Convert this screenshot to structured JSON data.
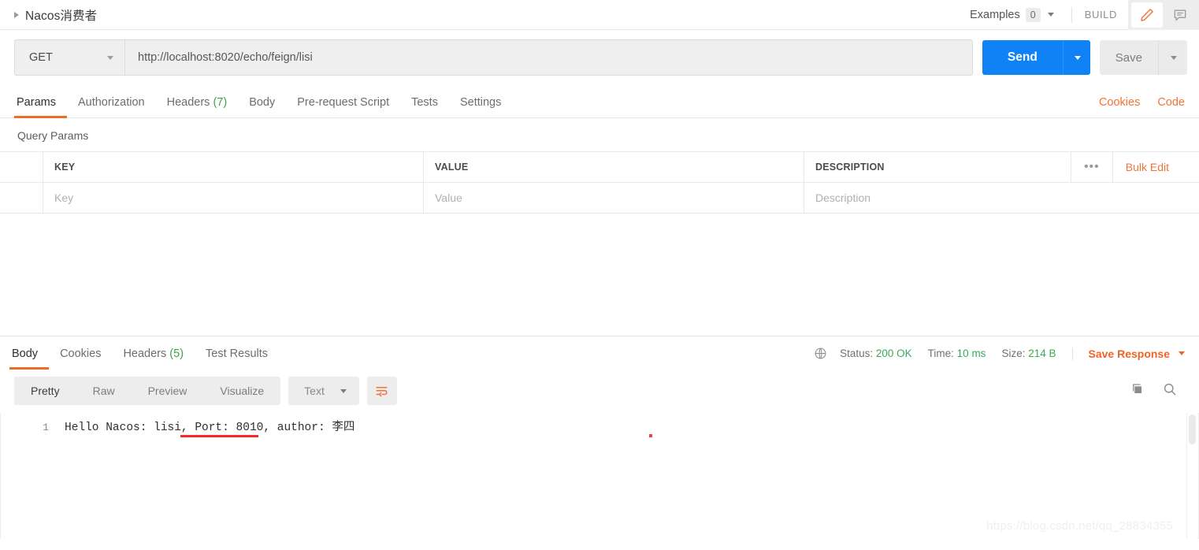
{
  "header": {
    "request_title": "Nacos消费者",
    "examples_label": "Examples",
    "examples_count": "0",
    "build_label": "BUILD",
    "edit_icon": "pencil-icon",
    "comment_icon": "comment-icon",
    "accent_orange": "#ef6c24"
  },
  "request": {
    "method": "GET",
    "url": "http://localhost:8020/echo/feign/lisi",
    "send_label": "Send",
    "save_label": "Save",
    "send_color": "#0f82f5"
  },
  "request_tabs": [
    {
      "label": "Params",
      "count": "",
      "active": true
    },
    {
      "label": "Authorization",
      "count": "",
      "active": false
    },
    {
      "label": "Headers",
      "count": "(7)",
      "active": false
    },
    {
      "label": "Body",
      "count": "",
      "active": false
    },
    {
      "label": "Pre-request Script",
      "count": "",
      "active": false
    },
    {
      "label": "Tests",
      "count": "",
      "active": false
    },
    {
      "label": "Settings",
      "count": "",
      "active": false
    }
  ],
  "request_tabs_right": {
    "cookies": "Cookies",
    "code": "Code"
  },
  "query_params": {
    "section_title": "Query Params",
    "columns": [
      "KEY",
      "VALUE",
      "DESCRIPTION"
    ],
    "row_placeholders": [
      "Key",
      "Value",
      "Description"
    ],
    "more_actions": "•••",
    "bulk_edit": "Bulk Edit"
  },
  "response_tabs": [
    {
      "label": "Body",
      "count": "",
      "active": true
    },
    {
      "label": "Cookies",
      "count": "",
      "active": false
    },
    {
      "label": "Headers",
      "count": "(5)",
      "active": false
    },
    {
      "label": "Test Results",
      "count": "",
      "active": false
    }
  ],
  "response_meta": {
    "globe_icon": "globe-icon",
    "status_label": "Status:",
    "status_value": "200 OK",
    "time_label": "Time:",
    "time_value": "10 ms",
    "size_label": "Size:",
    "size_value": "214 B",
    "save_response": "Save Response",
    "status_color": "#3aa956"
  },
  "format_bar": {
    "views": [
      "Pretty",
      "Raw",
      "Preview",
      "Visualize"
    ],
    "active_view": "Pretty",
    "type": "Text",
    "wrap_icon": "word-wrap-icon",
    "copy_icon": "copy-icon",
    "search_icon": "search-icon"
  },
  "response_body": {
    "line_number": "1",
    "text": "Hello Nacos: lisi, Port: 8010, author: 李四",
    "annotation_color": "#fb2a2a"
  },
  "watermark": "https://blog.csdn.net/qq_28834355"
}
